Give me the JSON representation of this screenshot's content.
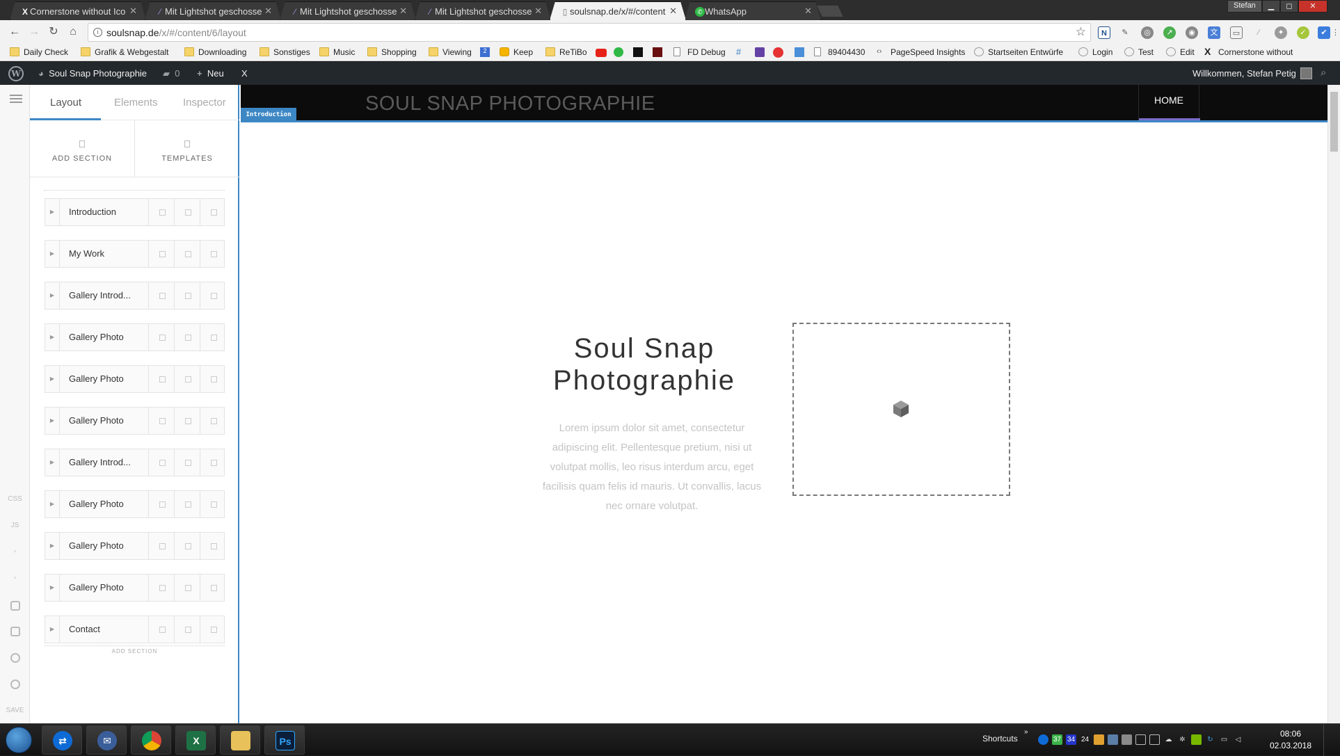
{
  "browser": {
    "tabs": [
      {
        "title": "Cornerstone without Ico",
        "favicon": "x-icon",
        "active": false
      },
      {
        "title": "Mit Lightshot geschosse",
        "favicon": "feather-icon",
        "active": false
      },
      {
        "title": "Mit Lightshot geschosse",
        "favicon": "feather-icon",
        "active": false
      },
      {
        "title": "Mit Lightshot geschosse",
        "favicon": "feather-icon",
        "active": false
      },
      {
        "title": "soulsnap.de/x/#/content",
        "favicon": "page-icon",
        "active": true
      },
      {
        "title": "WhatsApp",
        "favicon": "whatsapp-icon",
        "active": false
      }
    ],
    "window_user": "Stefan",
    "url": {
      "host": "soulsnap.de",
      "path": "/x/#/content/6/layout"
    },
    "bookmarks": [
      "Daily Check",
      "Grafik & Webgestalt",
      "Downloading",
      "Sonstiges",
      "Music",
      "Shopping",
      "Viewing",
      "Keep",
      "ReTiBo",
      "FD Debug",
      "89404430",
      "PageSpeed Insights",
      "Startseiten Entwürfe",
      "Login",
      "Test",
      "Edit",
      "Cornerstone without"
    ]
  },
  "wp_admin_bar": {
    "site_name": "Soul Snap Photographie",
    "comments_count": "0",
    "new_label": "Neu",
    "x_label": "X",
    "welcome": "Willkommen, Stefan Petig"
  },
  "rail": {
    "css_label": "CSS",
    "js_label": "JS",
    "save_label": "SAVE"
  },
  "panel": {
    "tabs": [
      "Layout",
      "Elements",
      "Inspector"
    ],
    "add_section_label": "ADD SECTION",
    "templates_label": "TEMPLATES",
    "sections": [
      "Introduction",
      "My Work",
      "Gallery Introd...",
      "Gallery Photo",
      "Gallery Photo",
      "Gallery Photo",
      "Gallery Introd...",
      "Gallery Photo",
      "Gallery Photo",
      "Gallery Photo",
      "Contact"
    ],
    "add_section_bottom": "ADD SECTION"
  },
  "preview": {
    "site_title": "SOUL SNAP PHOTOGRAPHIE",
    "nav_home": "HOME",
    "section_tag": "Introduction",
    "hero_title_line1": "Soul Snap",
    "hero_title_line2": "Photographie",
    "hero_body": "Lorem ipsum dolor sit amet, consectetur adipiscing elit. Pellentesque pretium, nisi ut volutpat mollis, leo risus interdum arcu, eget facilisis quam felis id mauris. Ut convallis, lacus nec ornare volutpat."
  },
  "taskbar": {
    "shortcuts_label": "Shortcuts",
    "tray_numbers": [
      "37",
      "34",
      "24"
    ],
    "time": "08:06",
    "date": "02.03.2018"
  },
  "colors": {
    "accent_blue": "#3d87c5",
    "wp_bar": "#23282d",
    "site_header": "#0c0c0c",
    "nav_underline": "#7c6cc9"
  }
}
